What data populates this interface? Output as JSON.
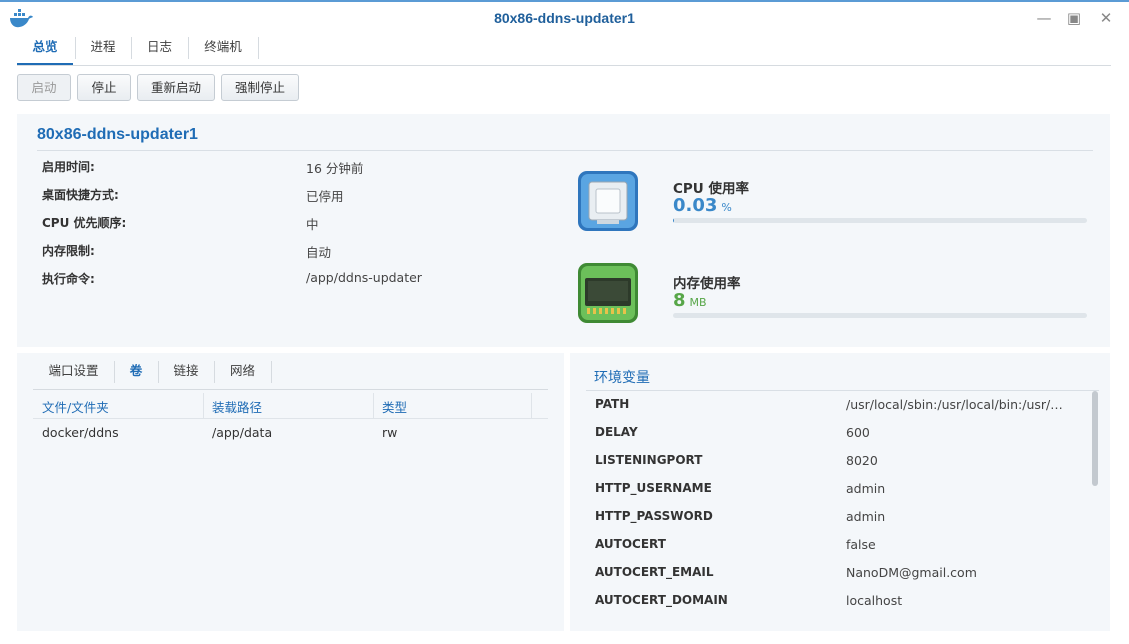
{
  "window": {
    "title": "80x86-ddns-updater1",
    "min_symbol": "—",
    "max_symbol": "▣",
    "close_symbol": "✕"
  },
  "tabs": [
    {
      "label": "总览",
      "active": true
    },
    {
      "label": "进程",
      "active": false
    },
    {
      "label": "日志",
      "active": false
    },
    {
      "label": "终端机",
      "active": false
    }
  ],
  "toolbar": {
    "start": "启动",
    "stop": "停止",
    "restart": "重新启动",
    "force_stop": "强制停止"
  },
  "overview": {
    "name": "80x86-ddns-updater1",
    "info": [
      {
        "label": "启用时间:",
        "value": "16 分钟前"
      },
      {
        "label": "桌面快捷方式:",
        "value": "已停用"
      },
      {
        "label": "CPU 优先顺序:",
        "value": "中"
      },
      {
        "label": "内存限制:",
        "value": "自动"
      },
      {
        "label": "执行命令:",
        "value": "/app/ddns-updater"
      }
    ],
    "cpu": {
      "label": "CPU 使用率",
      "value": "0.03",
      "unit": "%",
      "fraction": 0.0003,
      "color": "#3a88c9",
      "icon": "cpu-icon"
    },
    "memory": {
      "label": "内存使用率",
      "value": "8",
      "unit": "MB",
      "fraction": 0.0,
      "color": "#57a648",
      "icon": "memory-icon"
    }
  },
  "volume_panel": {
    "subtabs": [
      {
        "label": "端口设置",
        "active": false
      },
      {
        "label": "卷",
        "active": true
      },
      {
        "label": "链接",
        "active": false
      },
      {
        "label": "网络",
        "active": false
      }
    ],
    "columns": [
      "文件/文件夹",
      "装载路径",
      "类型"
    ],
    "rows": [
      {
        "file": "docker/ddns",
        "mount": "/app/data",
        "type": "rw"
      }
    ]
  },
  "env_panel": {
    "title": "环境变量",
    "vars": [
      {
        "key": "PATH",
        "value": "/usr/local/sbin:/usr/local/bin:/usr/sbin:/usr/bin:/sbin:/bin"
      },
      {
        "key": "DELAY",
        "value": "600"
      },
      {
        "key": "LISTENINGPORT",
        "value": "8020"
      },
      {
        "key": "HTTP_USERNAME",
        "value": "admin"
      },
      {
        "key": "HTTP_PASSWORD",
        "value": "admin"
      },
      {
        "key": "AUTOCERT",
        "value": "false"
      },
      {
        "key": "AUTOCERT_EMAIL",
        "value": "NanoDM@gmail.com"
      },
      {
        "key": "AUTOCERT_DOMAIN",
        "value": "localhost"
      }
    ]
  },
  "colors": {
    "accent": "#1f6cb5",
    "panel_bg": "#f4f7fa"
  }
}
